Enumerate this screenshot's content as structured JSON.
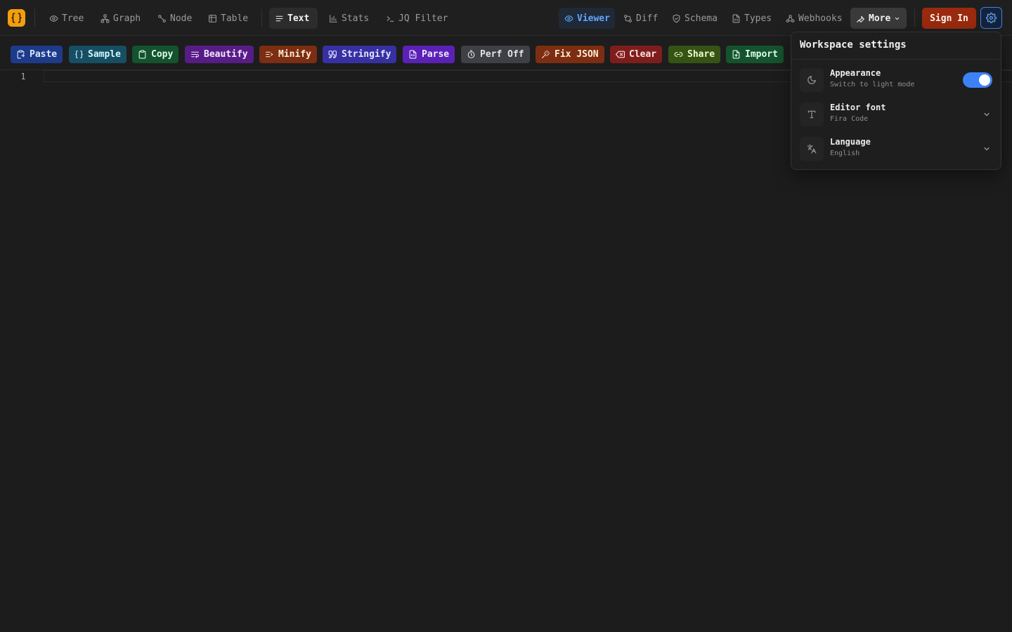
{
  "nav": {
    "tabs": [
      {
        "label": "Tree",
        "icon": "eye-icon"
      },
      {
        "label": "Graph",
        "icon": "graph-icon"
      },
      {
        "label": "Node",
        "icon": "node-icon"
      },
      {
        "label": "Table",
        "icon": "table-icon"
      },
      {
        "label": "Text",
        "icon": "text-lines-icon",
        "active": true
      },
      {
        "label": "Stats",
        "icon": "bar-chart-icon"
      },
      {
        "label": "JQ Filter",
        "icon": "terminal-icon"
      }
    ],
    "modes": [
      {
        "label": "Viewer",
        "icon": "eye-icon",
        "active": true
      },
      {
        "label": "Diff",
        "icon": "diff-icon"
      },
      {
        "label": "Schema",
        "icon": "shield-icon"
      },
      {
        "label": "Types",
        "icon": "file-code-icon"
      },
      {
        "label": "Webhooks",
        "icon": "webhook-icon"
      }
    ],
    "more_label": "More",
    "signin_label": "Sign In"
  },
  "toolbar": {
    "buttons": [
      {
        "label": "Paste",
        "icon": "clipboard-paste-icon",
        "bg": "#1e3a8a",
        "fg": "#dbeafe"
      },
      {
        "label": "Sample",
        "icon": "braces-icon",
        "bg": "#164e63",
        "fg": "#cffafe"
      },
      {
        "label": "Copy",
        "icon": "clipboard-icon",
        "bg": "#14532d",
        "fg": "#dcfce7"
      },
      {
        "label": "Beautify",
        "icon": "wrap-text-icon",
        "bg": "#581c87",
        "fg": "#f3e8ff"
      },
      {
        "label": "Minify",
        "icon": "minify-icon",
        "bg": "#7c2d12",
        "fg": "#ffedd5"
      },
      {
        "label": "Stringify",
        "icon": "quote-icon",
        "bg": "#3730a3",
        "fg": "#e0e7ff"
      },
      {
        "label": "Parse",
        "icon": "file-icon",
        "bg": "#5b21b6",
        "fg": "#ede9fe"
      },
      {
        "label": "Perf Off",
        "icon": "timer-icon",
        "bg": "#3f3f46",
        "fg": "#e4e4e7"
      },
      {
        "label": "Fix JSON",
        "icon": "wand-icon",
        "bg": "#7c2d12",
        "fg": "#ffedd5"
      },
      {
        "label": "Clear",
        "icon": "erase-icon",
        "bg": "#7f1d1d",
        "fg": "#fee2e2"
      },
      {
        "label": "Share",
        "icon": "link-icon",
        "bg": "#365314",
        "fg": "#ecfccb"
      },
      {
        "label": "Import",
        "icon": "file-import-icon",
        "bg": "#14532d",
        "fg": "#dcfce7"
      }
    ]
  },
  "editor": {
    "line_numbers": [
      "1"
    ]
  },
  "settings": {
    "title": "Workspace settings",
    "rows": [
      {
        "label": "Appearance",
        "sub": "Switch to light mode",
        "icon": "moon-icon",
        "control": "toggle",
        "on": true
      },
      {
        "label": "Editor font",
        "sub": "Fira Code",
        "icon": "type-icon",
        "control": "select"
      },
      {
        "label": "Language",
        "sub": "English",
        "icon": "translate-icon",
        "control": "select"
      }
    ]
  },
  "colors": {
    "accent": "#3b82f6",
    "logo": "#f59e0b",
    "signin": "#9a2a0e"
  }
}
